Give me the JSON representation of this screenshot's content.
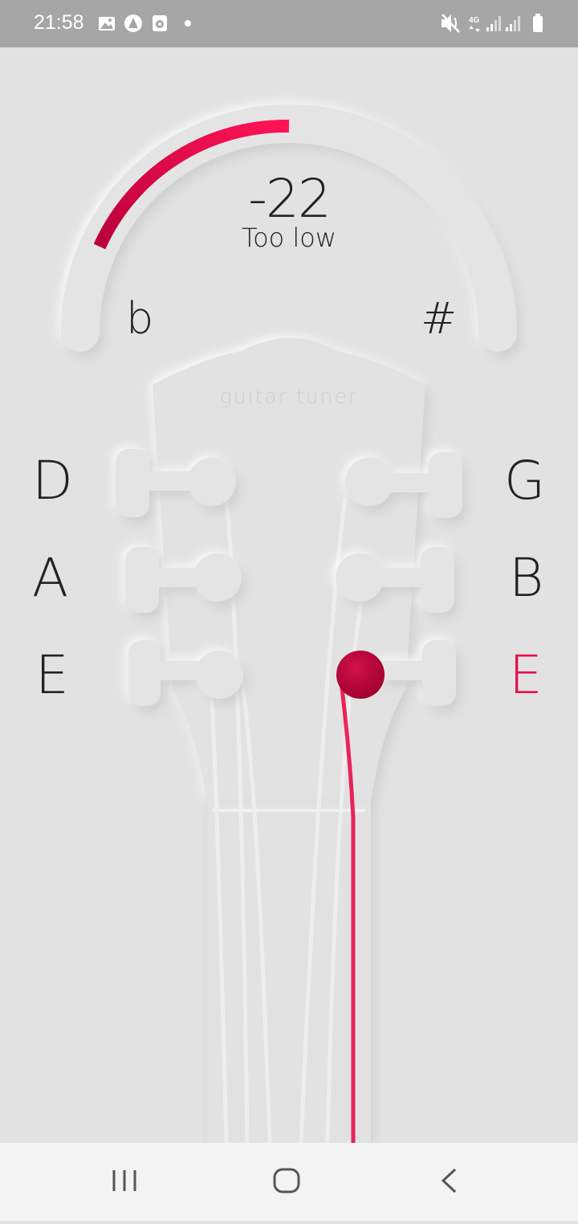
{
  "status_bar": {
    "time": "21:58",
    "icons": [
      "gallery-icon",
      "assistant-icon",
      "media-icon",
      "dot-icon",
      "mute-icon",
      "4g-icon",
      "signal-icon",
      "signal-icon",
      "battery-icon"
    ]
  },
  "tuner": {
    "cents": "-22",
    "status": "Too low",
    "flat_symbol": "b",
    "sharp_symbol": "#",
    "brand": "guitar tuner",
    "accent_color": "#e8104a"
  },
  "strings": {
    "left": [
      "D",
      "A",
      "E"
    ],
    "right": [
      "G",
      "B",
      "E"
    ],
    "active": "E (high)"
  },
  "nav_bar": {
    "buttons": [
      "recents-icon",
      "home-icon",
      "back-icon"
    ]
  }
}
